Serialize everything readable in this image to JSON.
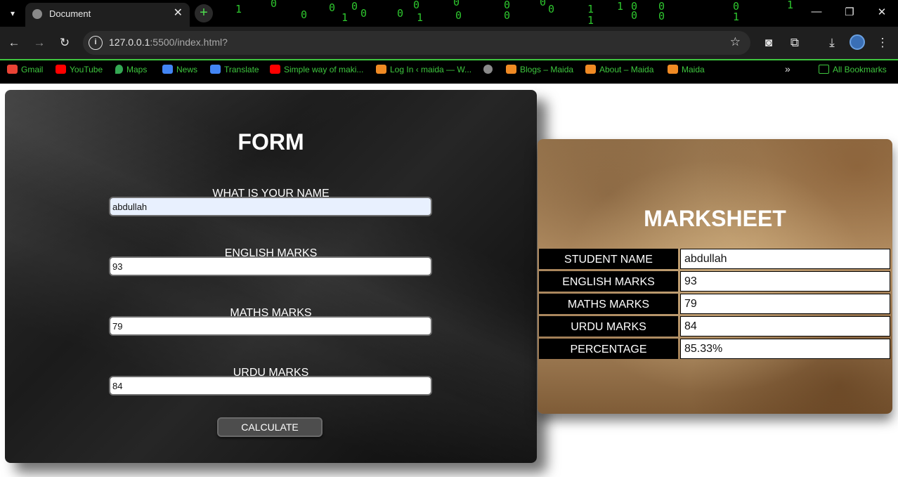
{
  "browser": {
    "tab_title": "Document",
    "url_host": "127.0.0.1",
    "url_rest": ":5500/index.html?",
    "bookmarks": [
      {
        "label": "Gmail",
        "color": "#ea4335"
      },
      {
        "label": "YouTube",
        "color": "#ff0000"
      },
      {
        "label": "Maps",
        "color": "#34a853"
      },
      {
        "label": "News",
        "color": "#4285f4"
      },
      {
        "label": "Translate",
        "color": "#4285f4"
      },
      {
        "label": "Simple way of maki...",
        "color": "#ff0000"
      },
      {
        "label": "Log In ‹ maida — W...",
        "color": "#f08a24"
      },
      {
        "label": "Blogs – Maida",
        "color": "#f08a24"
      },
      {
        "label": "About – Maida",
        "color": "#f08a24"
      },
      {
        "label": "Maida",
        "color": "#f08a24"
      }
    ],
    "all_bookmarks": "All Bookmarks"
  },
  "form": {
    "title": "FORM",
    "name_label": "WHAT IS YOUR NAME",
    "name_value": "abdullah",
    "english_label": "ENGLISH MARKS",
    "english_value": "93",
    "maths_label": "MATHS MARKS",
    "maths_value": "79",
    "urdu_label": "URDU MARKS",
    "urdu_value": "84",
    "calculate_label": "CALCULATE"
  },
  "marksheet": {
    "title": "MARKSHEET",
    "rows": [
      {
        "key": "STUDENT NAME",
        "value": "abdullah"
      },
      {
        "key": "ENGLISH MARKS",
        "value": "93"
      },
      {
        "key": "MATHS MARKS",
        "value": "79"
      },
      {
        "key": "URDU MARKS",
        "value": "84"
      },
      {
        "key": "PERCENTAGE",
        "value": "85.33%"
      }
    ]
  },
  "colors": {
    "bookmark_text": "#3ec63e",
    "chrome_dark": "#1f1f1f"
  }
}
